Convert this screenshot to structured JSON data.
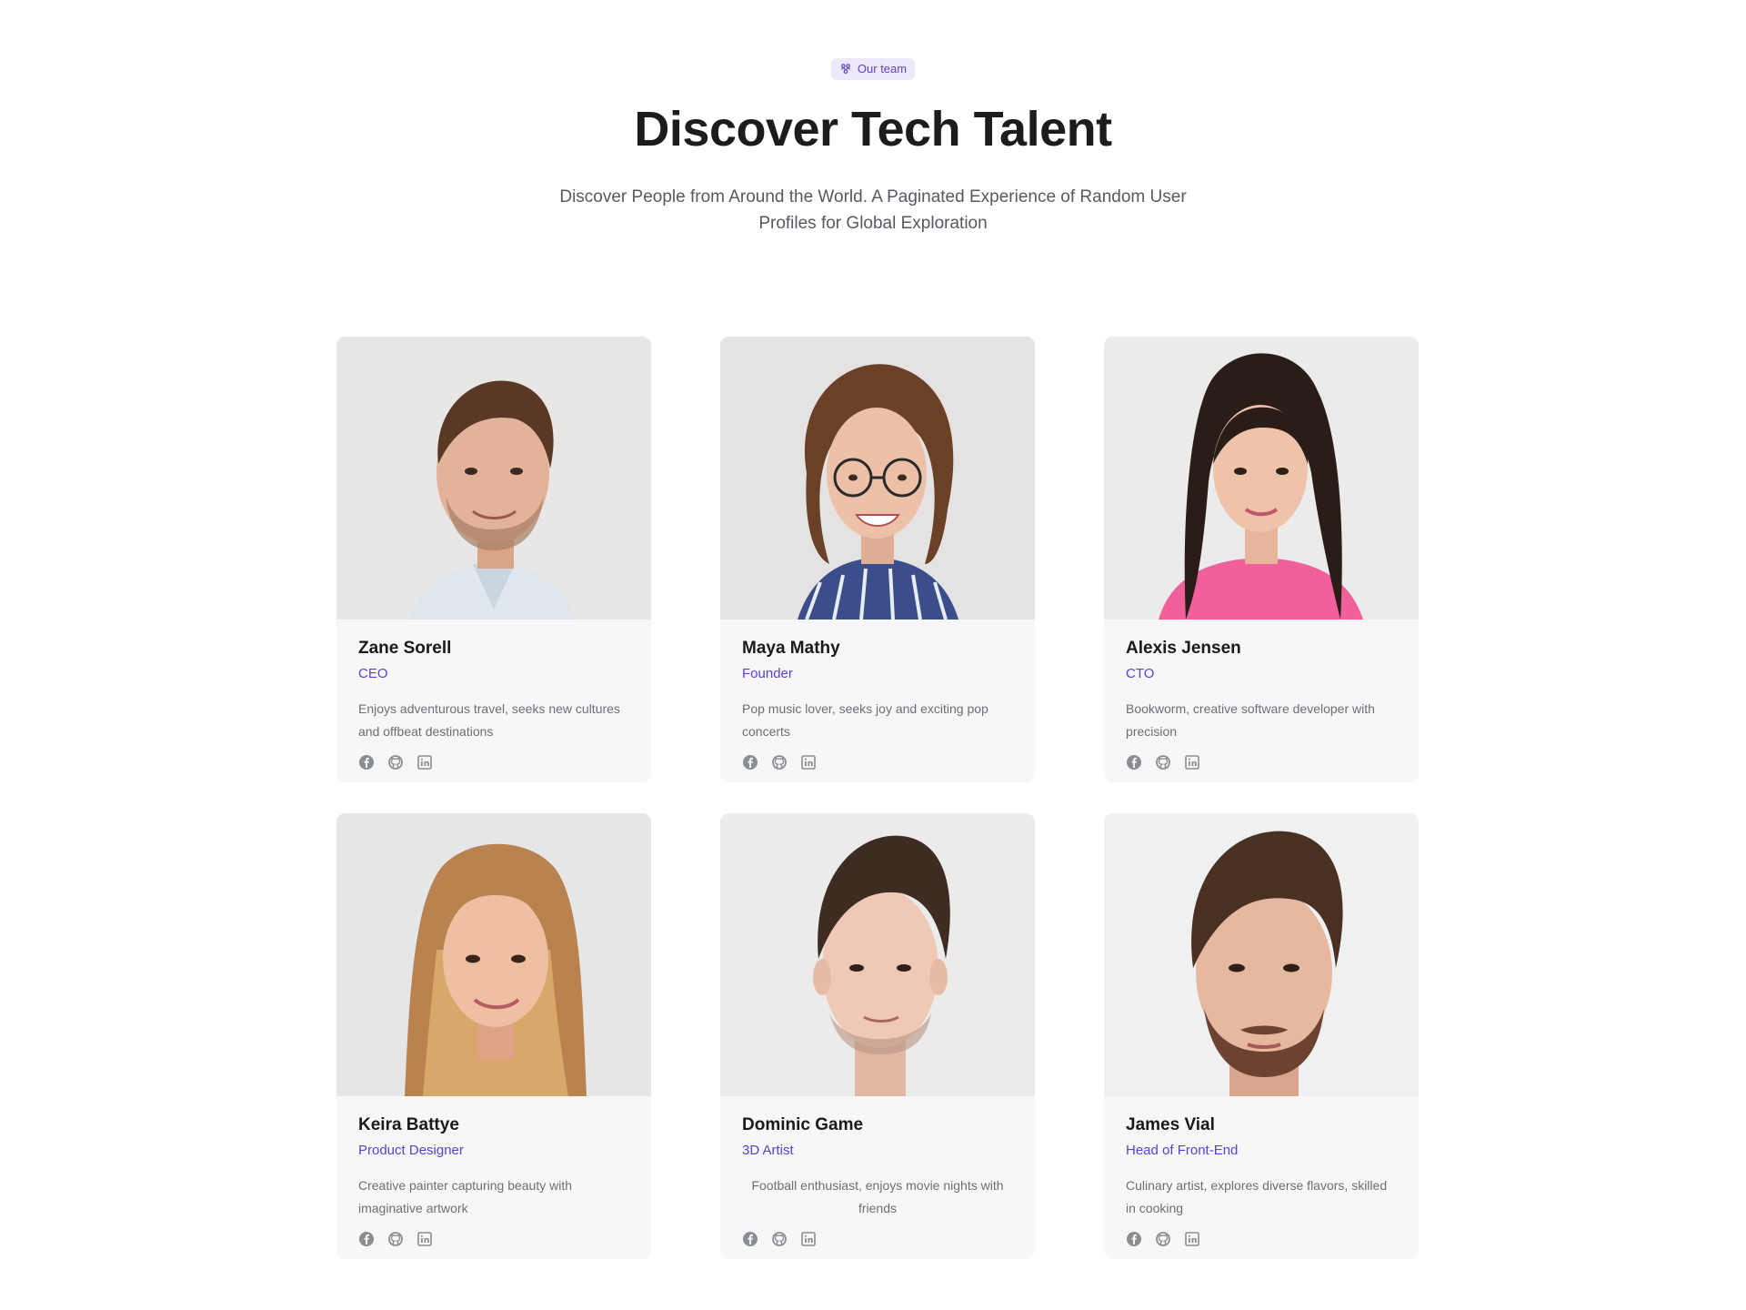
{
  "header": {
    "badge_label": "Our team",
    "badge_icon": "team-icon",
    "title": "Discover Tech Talent",
    "subtitle": "Discover People from Around the World. A Paginated Experience of Random User Profiles for Global Exploration"
  },
  "colors": {
    "accent": "#5b3fd6",
    "badge_bg": "#ede9fb",
    "card_bg": "#f7f7f7",
    "icon_gray": "#8a8d91"
  },
  "members": [
    {
      "name": "Zane Sorell",
      "role": "CEO",
      "bio": "Enjoys adventurous travel, seeks new cultures and offbeat destinations",
      "socials": [
        "facebook-icon",
        "github-icon",
        "linkedin-icon"
      ]
    },
    {
      "name": "Maya Mathy",
      "role": "Founder",
      "bio": "Pop music lover, seeks joy and exciting pop concerts",
      "socials": [
        "facebook-icon",
        "github-icon",
        "linkedin-icon"
      ]
    },
    {
      "name": "Alexis Jensen",
      "role": "CTO",
      "bio": "Bookworm, creative software developer with precision",
      "socials": [
        "facebook-icon",
        "github-icon",
        "linkedin-icon"
      ]
    },
    {
      "name": "Keira Battye",
      "role": "Product Designer",
      "bio": "Creative painter capturing beauty with imaginative artwork",
      "socials": [
        "facebook-icon",
        "github-icon",
        "linkedin-icon"
      ]
    },
    {
      "name": "Dominic Game",
      "role": "3D Artist",
      "bio": "Football enthusiast, enjoys movie nights with friends",
      "socials": [
        "facebook-icon",
        "github-icon",
        "linkedin-icon"
      ]
    },
    {
      "name": "James Vial",
      "role": "Head of Front-End",
      "bio": "Culinary artist, explores diverse flavors, skilled in cooking",
      "socials": [
        "facebook-icon",
        "github-icon",
        "linkedin-icon"
      ]
    }
  ]
}
